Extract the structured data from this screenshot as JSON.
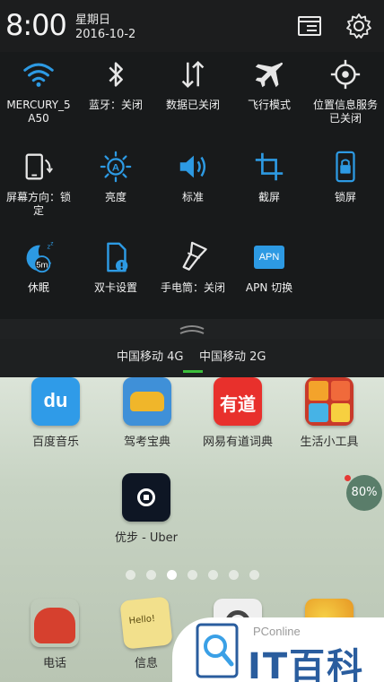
{
  "statusbar": {
    "time": "8:00",
    "weekday": "星期日",
    "date": "2016-10-2",
    "buttons": [
      {
        "name": "notification-manager-icon",
        "icon": "list-icon"
      },
      {
        "name": "settings-icon",
        "icon": "gear-icon"
      }
    ]
  },
  "tiles": [
    {
      "id": "wifi",
      "label": "MERCURY_5\nA50",
      "icon": "wifi-icon",
      "active": true
    },
    {
      "id": "bluetooth",
      "label": "蓝牙：关闭",
      "icon": "bluetooth-icon",
      "active": false
    },
    {
      "id": "data",
      "label": "数据已关闭",
      "icon": "mobile-data-icon",
      "active": false
    },
    {
      "id": "airplane",
      "label": "飞行模式",
      "icon": "airplane-icon",
      "active": false
    },
    {
      "id": "location",
      "label": "位置信息服务\n已关闭",
      "icon": "location-icon",
      "active": false
    },
    {
      "id": "rotation",
      "label": "屏幕方向：锁\n定",
      "icon": "rotation-lock-icon",
      "active": false
    },
    {
      "id": "brightness",
      "label": "亮度",
      "icon": "brightness-icon",
      "active": true
    },
    {
      "id": "sound",
      "label": "标准",
      "icon": "volume-icon",
      "active": true
    },
    {
      "id": "screenshot",
      "label": "截屏",
      "icon": "crop-icon",
      "active": true
    },
    {
      "id": "lockscreen",
      "label": "锁屏",
      "icon": "lock-screen-icon",
      "active": true
    },
    {
      "id": "sleep",
      "label": "休眠",
      "icon": "sleep-icon",
      "active": true,
      "badge": "5m"
    },
    {
      "id": "dualsim",
      "label": "双卡设置",
      "icon": "dual-sim-icon",
      "active": true
    },
    {
      "id": "flashlight",
      "label": "手电筒：关闭",
      "icon": "flashlight-icon",
      "active": false
    },
    {
      "id": "apn",
      "label": "APN 切换",
      "icon": "apn-icon",
      "active": true,
      "badge": "APN"
    }
  ],
  "carriers": [
    "中国移动 4G",
    "中国移动 2G"
  ],
  "home": {
    "apps_row1": [
      {
        "label": "百度音乐",
        "icon": "baidu-music-icon",
        "glyph": "du"
      },
      {
        "label": "驾考宝典",
        "icon": "driving-test-icon",
        "glyph": ""
      },
      {
        "label": "网易有道词典",
        "icon": "youdao-dict-icon",
        "glyph": "有道"
      },
      {
        "label": "生活小工具",
        "icon": "life-tools-icon",
        "glyph": ""
      }
    ],
    "apps_row2": [
      {
        "label": "优步 - Uber",
        "icon": "uber-icon"
      }
    ],
    "dock": [
      {
        "label": "电话",
        "icon": "phone-icon"
      },
      {
        "label": "信息",
        "icon": "messages-icon",
        "glyph": "Hello!"
      },
      {
        "label": "",
        "icon": "camera-icon"
      },
      {
        "label": "",
        "icon": "browser-icon"
      }
    ],
    "memory_badge": "80%",
    "pages": 7,
    "current_page": 3
  },
  "watermark": {
    "brand": "PConline",
    "text": "IT百科"
  },
  "colors": {
    "accent": "#2d9ae3",
    "inactive": "#e6e6e6",
    "indicator": "#3bbf3b"
  }
}
